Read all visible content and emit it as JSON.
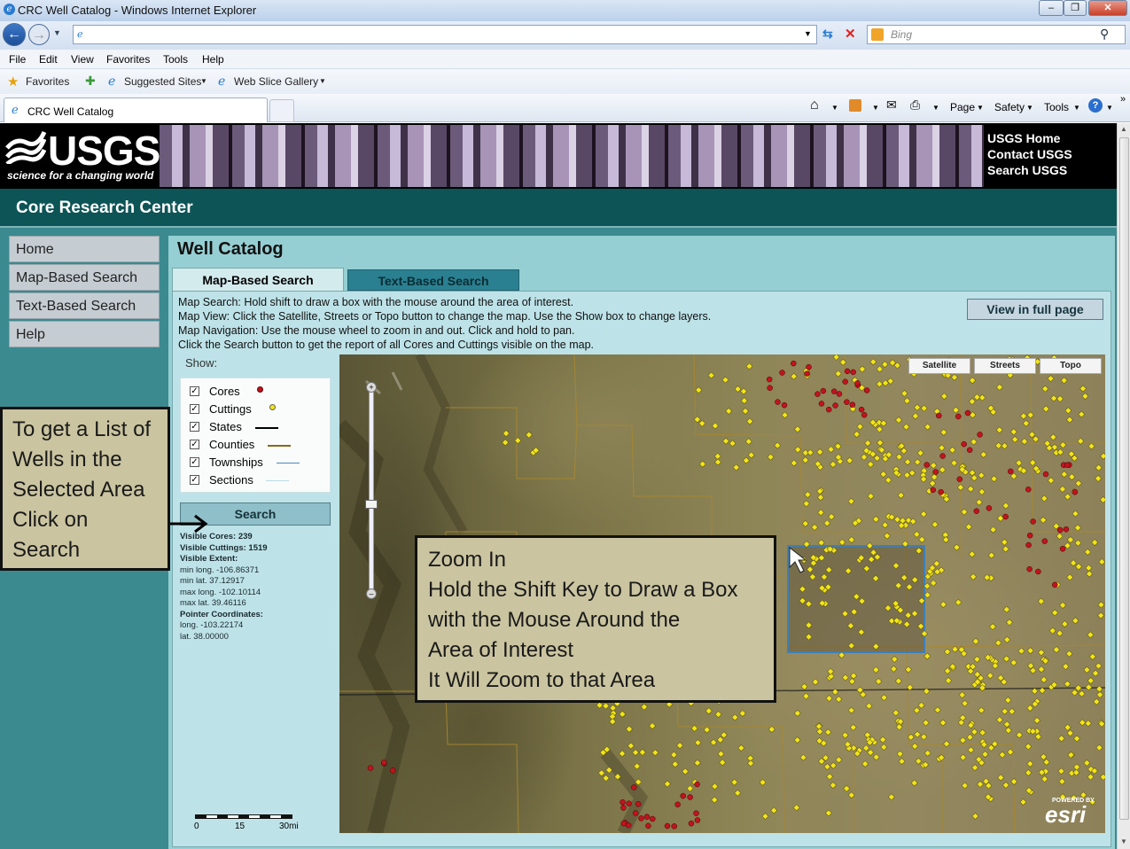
{
  "window": {
    "title": "CRC Well Catalog - Windows Internet Explorer"
  },
  "address": {
    "url": "",
    "search_placeholder": "Bing"
  },
  "menu": [
    "File",
    "Edit",
    "View",
    "Favorites",
    "Tools",
    "Help"
  ],
  "favorites_bar": {
    "favorites": "Favorites",
    "suggested": "Suggested Sites",
    "webslice": "Web Slice Gallery"
  },
  "tab": {
    "label": "CRC Well Catalog"
  },
  "command_bar": {
    "page": "Page",
    "safety": "Safety",
    "tools": "Tools"
  },
  "header": {
    "logo_word": "USGS",
    "logo_tagline": "science for a changing world",
    "links": [
      "USGS Home",
      "Contact USGS",
      "Search USGS"
    ],
    "site_title": "Core Research Center"
  },
  "sidebar": {
    "items": [
      "Home",
      "Map-Based Search",
      "Text-Based Search",
      "Help"
    ]
  },
  "catalog": {
    "title": "Well Catalog",
    "tabs": [
      "Map-Based Search",
      "Text-Based Search"
    ],
    "view_full": "View in full page",
    "instructions": [
      "Map Search: Hold shift to draw a box with the mouse around the area of interest.",
      "Map View: Click the Satellite, Streets or Topo button to change the map. Use the Show box to change layers.",
      "Map Navigation: Use the mouse wheel to zoom in and out. Click and hold to pan.",
      "Click the Search button to get the report of all Cores and Cuttings visible on the map."
    ],
    "show_label": "Show:",
    "layers": [
      {
        "label": "Cores",
        "checked": true,
        "symbol": "red-dot",
        "color": "#c0141e"
      },
      {
        "label": "Cuttings",
        "checked": true,
        "symbol": "yellow-dot",
        "color": "#f2e41a"
      },
      {
        "label": "States",
        "checked": true,
        "symbol": "line",
        "color": "#000000"
      },
      {
        "label": "Counties",
        "checked": true,
        "symbol": "line",
        "color": "#8a6a1a"
      },
      {
        "label": "Townships",
        "checked": true,
        "symbol": "line",
        "color": "#4a8ac0"
      },
      {
        "label": "Sections",
        "checked": true,
        "symbol": "line",
        "color": "#b8dce6"
      }
    ],
    "search_button": "Search",
    "stats": {
      "visible_cores_label": "Visible Cores:",
      "visible_cores": "239",
      "visible_cuttings_label": "Visible Cuttings:",
      "visible_cuttings": "1519",
      "visible_extent_label": "Visible Extent:",
      "min_long": "min long. -106.86371",
      "min_lat": "min lat. 37.12917",
      "max_long": "max long. -102.10114",
      "max_lat": "max lat. 39.46116",
      "pointer_label": "Pointer Coordinates:",
      "pointer_long": "long. -103.22174",
      "pointer_lat": "lat. 38.00000"
    },
    "map_buttons": [
      "Satellite",
      "Streets",
      "Topo"
    ],
    "scale": {
      "labels": [
        "0",
        "15",
        "30mi"
      ]
    },
    "esri_label": "esri",
    "esri_powered": "POWERED BY"
  },
  "callouts": {
    "left": [
      "To get a List of",
      "Wells in the",
      "Selected Area",
      "Click on",
      "Search"
    ],
    "zoom": [
      "Zoom In",
      "Hold the Shift Key to Draw a Box",
      "with the Mouse Around the",
      "Area of Interest",
      "It Will Zoom to that Area"
    ]
  },
  "colors": {
    "teal_dark": "#0d5457",
    "teal_page": "#3b8a90",
    "panel": "#bde2e8",
    "callout": "#cac4a0",
    "core": "#c0141e",
    "cutting": "#f2e41a"
  }
}
